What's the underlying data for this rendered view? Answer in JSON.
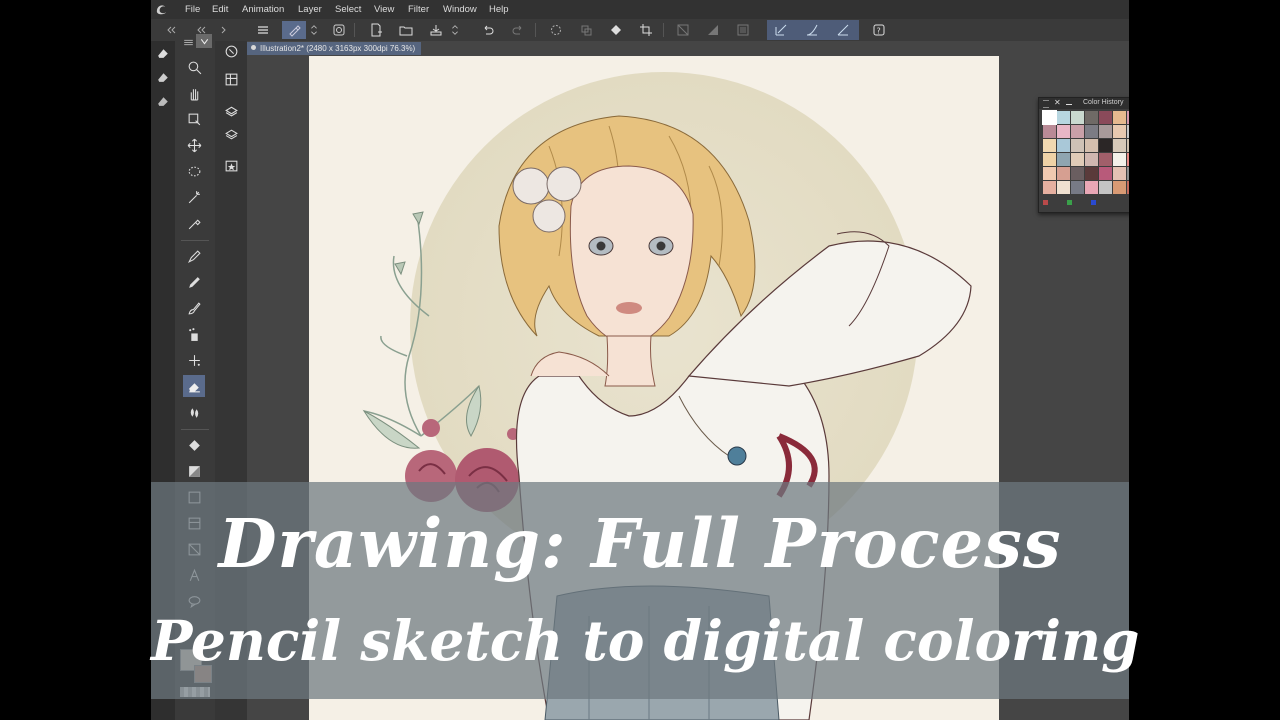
{
  "app": {
    "menu": [
      "File",
      "Edit",
      "Animation",
      "Layer",
      "Select",
      "View",
      "Filter",
      "Window",
      "Help"
    ]
  },
  "document": {
    "tab_label": "Illustration2* (2480 x 3163px 300dpi 76.3%)"
  },
  "color_history": {
    "title": "Color History",
    "swatches": [
      "#ffffff",
      "#b7d6e0",
      "#c9d9cf",
      "#6f6a66",
      "#8a4a5a",
      "#e6b98f",
      "#d79aae",
      "#c26b86",
      "#b98a96",
      "#e8b6c6",
      "#c9a0a8",
      "#7c7c84",
      "#a89a9a",
      "#e8c9b0",
      "#c7c7c7",
      "#d8d8d8",
      "#f1d8b0",
      "#a9c8d8",
      "#cfc2b6",
      "#d4bfae",
      "#2b2626",
      "#d7c9b9",
      "#cdbfae",
      "#a7a0a0",
      "#efd2a6",
      "#8fa5b0",
      "#e0cbb7",
      "#d0b7b0",
      "#a15f6a",
      "#f4f1ea",
      "#e78a86",
      "#8aa9b8",
      "#f0c9b0",
      "#d69f91",
      "#6a5e60",
      "#5a3a3a",
      "#b85a7a",
      "#e4c1b3",
      "#8e8e8e",
      "#b9c4c8",
      "#e6b0a0",
      "#f0e0d0",
      "#777a86",
      "#e9a7b6",
      "#c4c4c4",
      "#d89a74",
      "#c46a5c",
      "#4a5a66"
    ],
    "footer_dots": [
      "#b94a4a",
      "#3aa04a",
      "#2a4ad0"
    ]
  },
  "overlay": {
    "title": "Drawing: Full Process",
    "subtitle": "Pencil sketch to digital coloring"
  },
  "colors": {
    "ui_dark": "#3c3c3c",
    "active_blue": "#5a6b8c",
    "overlay": "#6e7880"
  }
}
